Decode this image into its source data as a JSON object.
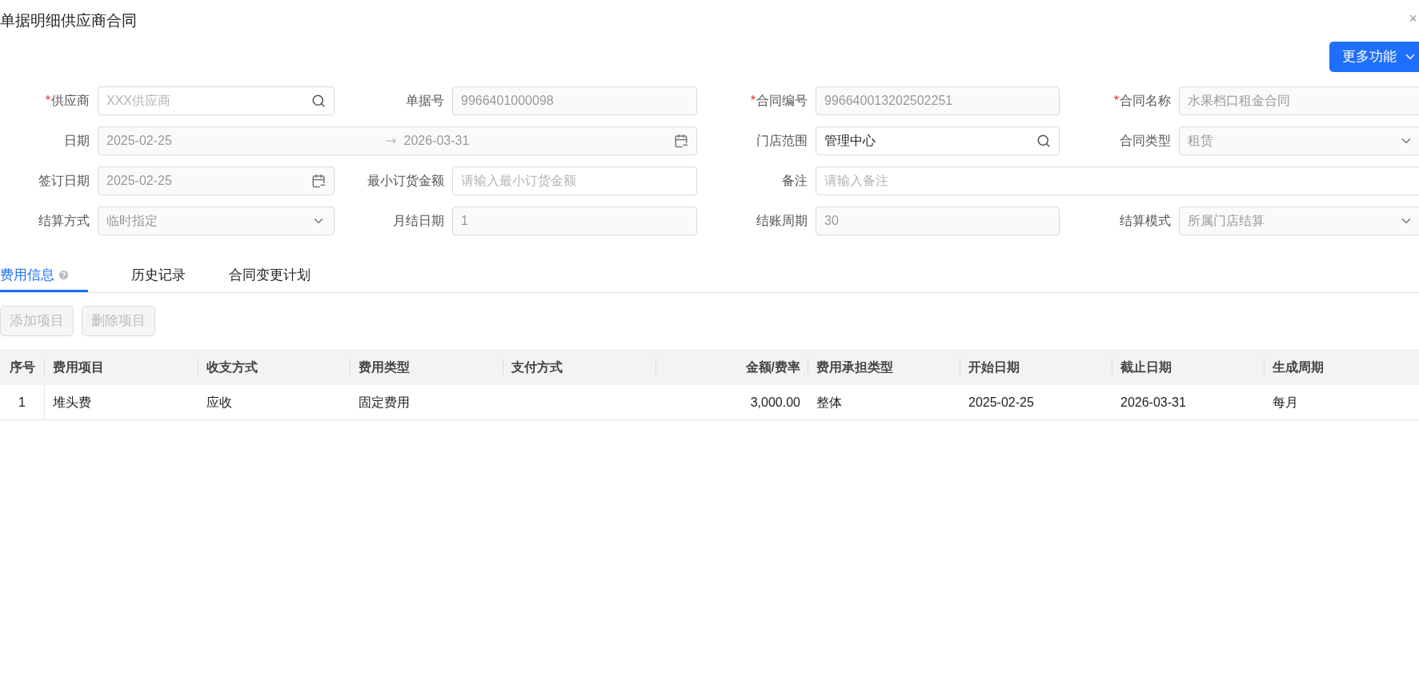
{
  "window": {
    "title": "单据明细供应商合同",
    "close": "×"
  },
  "more_button": {
    "label": "更多功能"
  },
  "form": {
    "fields": [
      {
        "label": "供应商",
        "required_mark": "*",
        "kind": "search",
        "placeholder": "XXX供应商",
        "disabled": false,
        "wide": false
      },
      {
        "label": "单据号",
        "kind": "text",
        "value": "9966401000098",
        "disabled": true,
        "wide": false
      },
      {
        "label": "合同编号",
        "required_mark": "*",
        "kind": "text",
        "value": "996640013202502251",
        "disabled": true,
        "wide": false
      },
      {
        "label": "合同名称",
        "required_mark": "*",
        "kind": "text",
        "value": "水果档口租金合同",
        "disabled": true,
        "wide": false
      },
      {
        "label": "日期",
        "kind": "daterange",
        "value": "2025-02-25",
        "value_end": "2026-03-31",
        "disabled": true,
        "wide": true
      },
      {
        "label": "门店范围",
        "kind": "search",
        "value": "管理中心",
        "disabled": false,
        "wide": false
      },
      {
        "label": "合同类型",
        "kind": "select",
        "value": "租赁",
        "disabled": true,
        "wide": false
      },
      {
        "label": "签订日期",
        "kind": "date",
        "value": "2025-02-25",
        "disabled": true,
        "wide": false
      },
      {
        "label": "最小订货金额",
        "kind": "text",
        "placeholder": "请输入最小订货金额",
        "disabled": false,
        "wide": false
      },
      {
        "label": "备注",
        "kind": "text",
        "placeholder": "请输入备注",
        "disabled": false,
        "wide": true
      },
      {
        "label": "结算方式",
        "kind": "select",
        "value": "临时指定",
        "disabled": true,
        "wide": false
      },
      {
        "label": "月结日期",
        "kind": "text",
        "value": "1",
        "disabled": true,
        "wide": false
      },
      {
        "label": "结账周期",
        "kind": "text",
        "value": "30",
        "disabled": true,
        "wide": false
      },
      {
        "label": "结算模式",
        "kind": "select",
        "value": "所属门店结算",
        "disabled": true,
        "wide": false
      }
    ]
  },
  "tabs": [
    {
      "label": "费用信息",
      "selected": true,
      "help": true
    },
    {
      "label": "历史记录",
      "selected": false,
      "help": false
    },
    {
      "label": "合同变更计划",
      "selected": false,
      "help": false
    }
  ],
  "actions": [
    {
      "label": "添加项目",
      "disabled": true
    },
    {
      "label": "删除项目",
      "disabled": true
    }
  ],
  "table": {
    "columns": [
      "序号",
      "费用项目",
      "收支方式",
      "费用类型",
      "支付方式",
      "金额/费率",
      "费用承担类型",
      "开始日期",
      "截止日期",
      "生成周期"
    ],
    "rows": [
      [
        "1",
        "堆头费",
        "应收",
        "固定费用",
        "",
        "3,000.00",
        "整体",
        "2025-02-25",
        "2026-03-31",
        "每月"
      ]
    ]
  }
}
